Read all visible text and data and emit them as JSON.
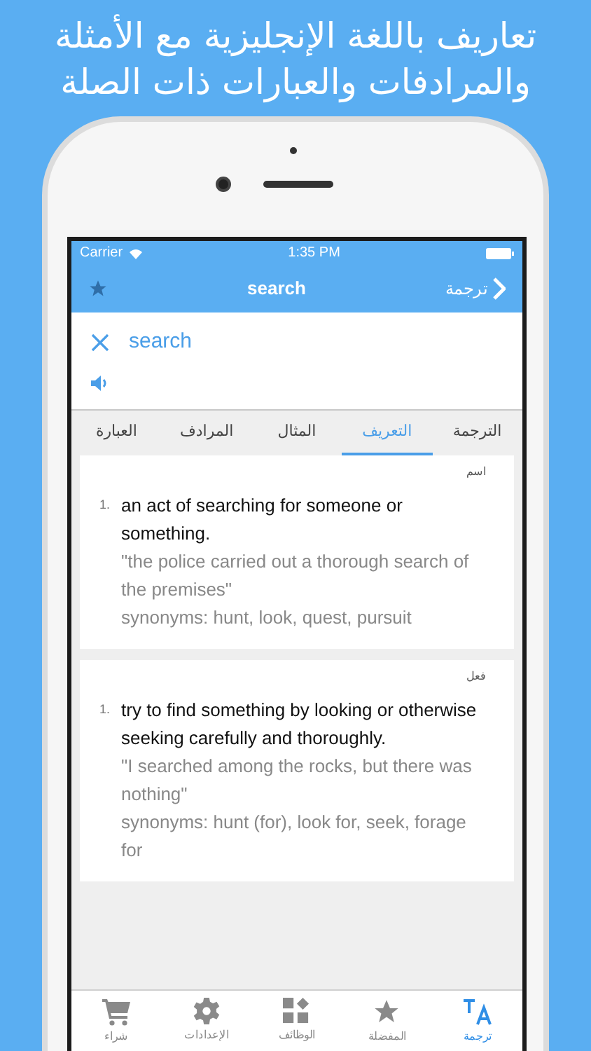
{
  "headline": "تعاريف باللغة الإنجليزية مع الأمثلة والمرادفات والعبارات ذات الصلة",
  "status_bar": {
    "carrier": "Carrier",
    "time": "1:35 PM"
  },
  "nav_bar": {
    "title": "search",
    "back_label": "ترجمة"
  },
  "search": {
    "value": "search"
  },
  "segments": [
    {
      "label": "الترجمة",
      "selected": false
    },
    {
      "label": "التعريف",
      "selected": true
    },
    {
      "label": "المثال",
      "selected": false
    },
    {
      "label": "المرادف",
      "selected": false
    },
    {
      "label": "العبارة",
      "selected": false
    }
  ],
  "entries": [
    {
      "part_of_speech": "اسم",
      "number": "1.",
      "definition": "an act of searching for someone or something.",
      "example": "\"the police carried out a thorough search of the premises\"",
      "synonyms": "synonyms: hunt, look, quest, pursuit"
    },
    {
      "part_of_speech": "فعل",
      "number": "1.",
      "definition": "try to find something by looking or otherwise seeking carefully and thoroughly.",
      "example": "\"I searched among the rocks, but there was nothing\"",
      "synonyms": "synonyms: hunt (for), look for, seek, forage for"
    }
  ],
  "tab_bar": [
    {
      "kind": "translate",
      "label": "ترجمة",
      "selected": true
    },
    {
      "kind": "star",
      "label": "المفضلة",
      "selected": false
    },
    {
      "kind": "widgets",
      "label": "الوظائف",
      "selected": false
    },
    {
      "kind": "gear",
      "label": "الإعدادات",
      "selected": false
    },
    {
      "kind": "cart",
      "label": "شراء",
      "selected": false
    }
  ]
}
